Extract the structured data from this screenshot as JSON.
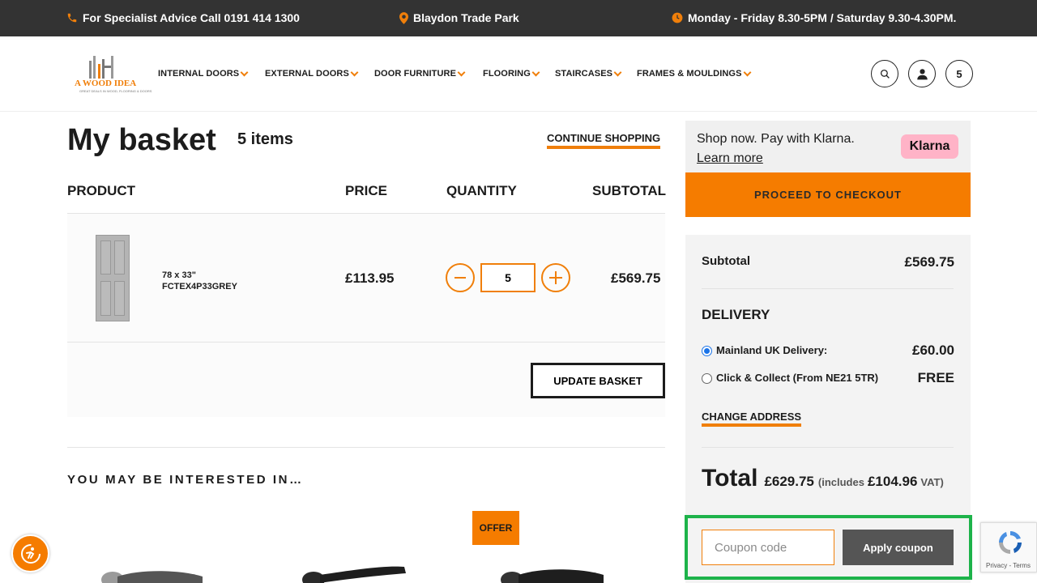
{
  "topbar": {
    "phone": "For Specialist Advice Call 0191 414 1300",
    "location": "Blaydon Trade Park",
    "hours": "Monday - Friday 8.30-5PM / Saturday 9.30-4.30PM."
  },
  "logo": {
    "text": "A WOOD IDEA",
    "tagline": "GREAT DEALS IN WOOD, FLOORING & DOORS"
  },
  "nav": [
    "INTERNAL DOORS",
    "EXTERNAL DOORS",
    "DOOR FURNITURE",
    "FLOORING",
    "STAIRCASES",
    "FRAMES & MOULDINGS"
  ],
  "header": {
    "basket_count": "5"
  },
  "basket": {
    "title": "My basket",
    "count": "5 items",
    "continue": "CONTINUE SHOPPING",
    "columns": {
      "product": "PRODUCT",
      "price": "PRICE",
      "quantity": "QUANTITY",
      "subtotal": "SUBTOTAL"
    },
    "item": {
      "size": "78 x 33\"",
      "sku": "FCTEX4P33GREY",
      "price": "£113.95",
      "quantity": "5",
      "subtotal": "£569.75"
    },
    "update": "UPDATE BASKET",
    "interest": "YOU MAY BE INTERESTED IN…",
    "offer": "OFFER"
  },
  "klarna": {
    "line1": "Shop now. Pay with Klarna.",
    "learn": "Learn more",
    "badge": "Klarna"
  },
  "checkout": "PROCEED TO CHECKOUT",
  "summary": {
    "subtotal_label": "Subtotal",
    "subtotal_value": "£569.75",
    "delivery_heading": "DELIVERY",
    "mainland_label": "Mainland UK Delivery:",
    "mainland_value": "£60.00",
    "collect_label": "Click & Collect (From NE21 5TR)",
    "collect_value": "FREE",
    "change_address": "CHANGE ADDRESS",
    "total_label": "Total",
    "total_value": "£629.75",
    "includes": "(includes",
    "vat_value": "£104.96",
    "vat_label": "VAT)"
  },
  "coupon": {
    "placeholder": "Coupon code",
    "apply": "Apply coupon"
  },
  "recaptcha": {
    "text": "Privacy - Terms"
  },
  "colors": {
    "accent": "#f57c00",
    "topbar": "#333333",
    "highlight": "#1db34a"
  }
}
